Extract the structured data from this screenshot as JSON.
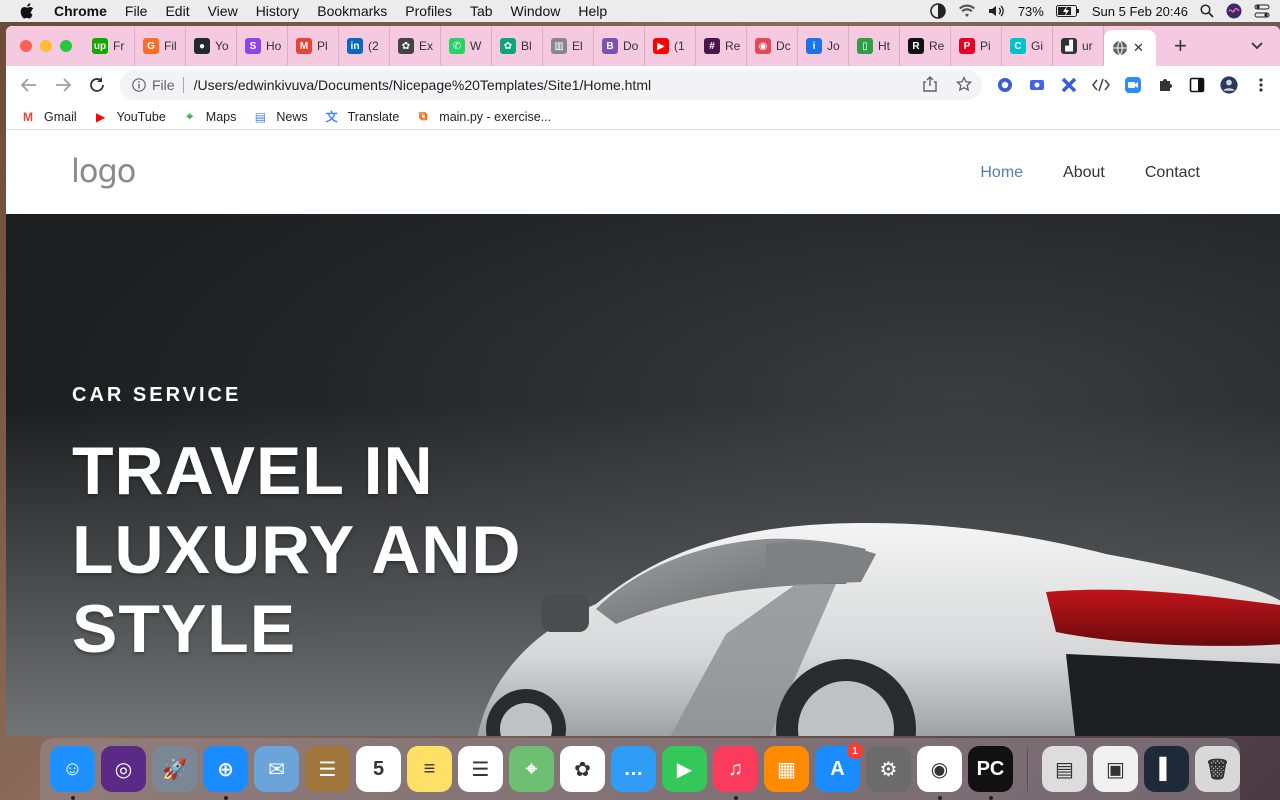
{
  "menubar": {
    "app": "Chrome",
    "items": [
      "File",
      "Edit",
      "View",
      "History",
      "Bookmarks",
      "Profiles",
      "Tab",
      "Window",
      "Help"
    ],
    "battery": "73%",
    "datetime": "Sun 5 Feb  20:46"
  },
  "tabs": [
    {
      "label": "Fr",
      "icon": "upwork-icon",
      "color": "#14a800",
      "glyph": "up"
    },
    {
      "label": "Fil",
      "icon": "gitlab-icon",
      "color": "#fc6d26",
      "glyph": "G"
    },
    {
      "label": "Yo",
      "icon": "github-icon",
      "color": "#24292f",
      "glyph": "●"
    },
    {
      "label": "Ho",
      "icon": "s-icon",
      "color": "#8e44ec",
      "glyph": "S"
    },
    {
      "label": "Pl",
      "icon": "gmail-icon",
      "color": "#ea4335",
      "glyph": "M"
    },
    {
      "label": "(2",
      "icon": "linkedin-icon",
      "color": "#0a66c2",
      "glyph": "in"
    },
    {
      "label": "Ex",
      "icon": "openai-icon",
      "color": "#444",
      "glyph": "✿"
    },
    {
      "label": "W",
      "icon": "whatsapp-icon",
      "color": "#25d366",
      "glyph": "✆"
    },
    {
      "label": "Bl",
      "icon": "chatgpt-icon",
      "color": "#10a37f",
      "glyph": "✿"
    },
    {
      "label": "El",
      "icon": "chart-icon",
      "color": "#888",
      "glyph": "▥"
    },
    {
      "label": "Do",
      "icon": "bootstrap-icon",
      "color": "#7952b3",
      "glyph": "B"
    },
    {
      "label": "(1",
      "icon": "youtube-icon",
      "color": "#ff0000",
      "glyph": "▶"
    },
    {
      "label": "Re",
      "icon": "slack-icon",
      "color": "#4a154b",
      "glyph": "#"
    },
    {
      "label": "Dc",
      "icon": "docs-icon",
      "color": "#e04a5a",
      "glyph": "◉"
    },
    {
      "label": "Jo",
      "icon": "job-icon",
      "color": "#1a73e8",
      "glyph": "i"
    },
    {
      "label": "Ht",
      "icon": "html-icon",
      "color": "#2ea043",
      "glyph": "▯"
    },
    {
      "label": "Re",
      "icon": "r-icon",
      "color": "#111",
      "glyph": "R"
    },
    {
      "label": "Pi",
      "icon": "pinterest-icon",
      "color": "#e60023",
      "glyph": "P"
    },
    {
      "label": "Gi",
      "icon": "canva-icon",
      "color": "#00c4cc",
      "glyph": "C"
    },
    {
      "label": "ur",
      "icon": "nicepage-icon",
      "color": "#333",
      "glyph": "▟"
    }
  ],
  "active_tab": {
    "icon": "globe-icon"
  },
  "omnibox": {
    "scheme_label": "File",
    "url": "/Users/edwinkivuva/Documents/Nicepage%20Templates/Site1/Home.html"
  },
  "bookmarks": [
    {
      "label": "Gmail",
      "icon": "gmail-icon"
    },
    {
      "label": "YouTube",
      "icon": "youtube-icon"
    },
    {
      "label": "Maps",
      "icon": "maps-icon"
    },
    {
      "label": "News",
      "icon": "news-icon"
    },
    {
      "label": "Translate",
      "icon": "translate-icon"
    },
    {
      "label": "main.py - exercise...",
      "icon": "replit-icon"
    }
  ],
  "site": {
    "logo": "logo",
    "nav": [
      "Home",
      "About",
      "Contact"
    ],
    "hero": {
      "eyebrow": "CAR SERVICE",
      "headline": [
        "TRAVEL IN",
        "LUXURY AND",
        "STYLE"
      ]
    }
  },
  "dock": [
    {
      "name": "finder-icon",
      "color": "#1e90ff",
      "glyph": "☺",
      "running": true
    },
    {
      "name": "siri-icon",
      "color": "#5b2a86",
      "glyph": "◎",
      "running": false
    },
    {
      "name": "launchpad-icon",
      "color": "#7a8795",
      "glyph": "🚀",
      "running": false
    },
    {
      "name": "safari-icon",
      "color": "#1a8cff",
      "glyph": "⊕",
      "running": true
    },
    {
      "name": "mail-icon",
      "color": "#6aa4d8",
      "glyph": "✉",
      "running": false
    },
    {
      "name": "contacts-icon",
      "color": "#a0763c",
      "glyph": "☰",
      "running": false
    },
    {
      "name": "calendar-icon",
      "color": "#ffffff",
      "glyph": "5",
      "running": false
    },
    {
      "name": "notes-icon",
      "color": "#ffe066",
      "glyph": "≡",
      "running": false
    },
    {
      "name": "reminders-icon",
      "color": "#ffffff",
      "glyph": "☰",
      "running": false
    },
    {
      "name": "maps-icon",
      "color": "#6fbf73",
      "glyph": "⌖",
      "running": false
    },
    {
      "name": "photos-icon",
      "color": "#ffffff",
      "glyph": "✿",
      "running": false
    },
    {
      "name": "messages-icon",
      "color": "#2f9cf5",
      "glyph": "…",
      "running": false
    },
    {
      "name": "facetime-icon",
      "color": "#34c759",
      "glyph": "▶",
      "running": false
    },
    {
      "name": "music-icon",
      "color": "#fb3b5c",
      "glyph": "♫",
      "running": true
    },
    {
      "name": "books-icon",
      "color": "#ff8c00",
      "glyph": "▦",
      "running": false
    },
    {
      "name": "app-store-icon",
      "color": "#1a8cff",
      "glyph": "A",
      "running": false,
      "badge": "1"
    },
    {
      "name": "system-preferences-icon",
      "color": "#6b6b6b",
      "glyph": "⚙",
      "running": false
    },
    {
      "name": "chrome-icon",
      "color": "#ffffff",
      "glyph": "◉",
      "running": true
    },
    {
      "name": "pycharm-icon",
      "color": "#111111",
      "glyph": "PC",
      "running": true
    }
  ],
  "dock_right": [
    {
      "name": "disk-utility-icon",
      "color": "#dddddd",
      "glyph": "▤"
    },
    {
      "name": "preview-window-icon",
      "color": "#f0f0f0",
      "glyph": "▣"
    },
    {
      "name": "terminal-window-icon",
      "color": "#1e2a3a",
      "glyph": "▌"
    },
    {
      "name": "trash-icon",
      "color": "#d8d8d8",
      "glyph": "🗑"
    }
  ]
}
